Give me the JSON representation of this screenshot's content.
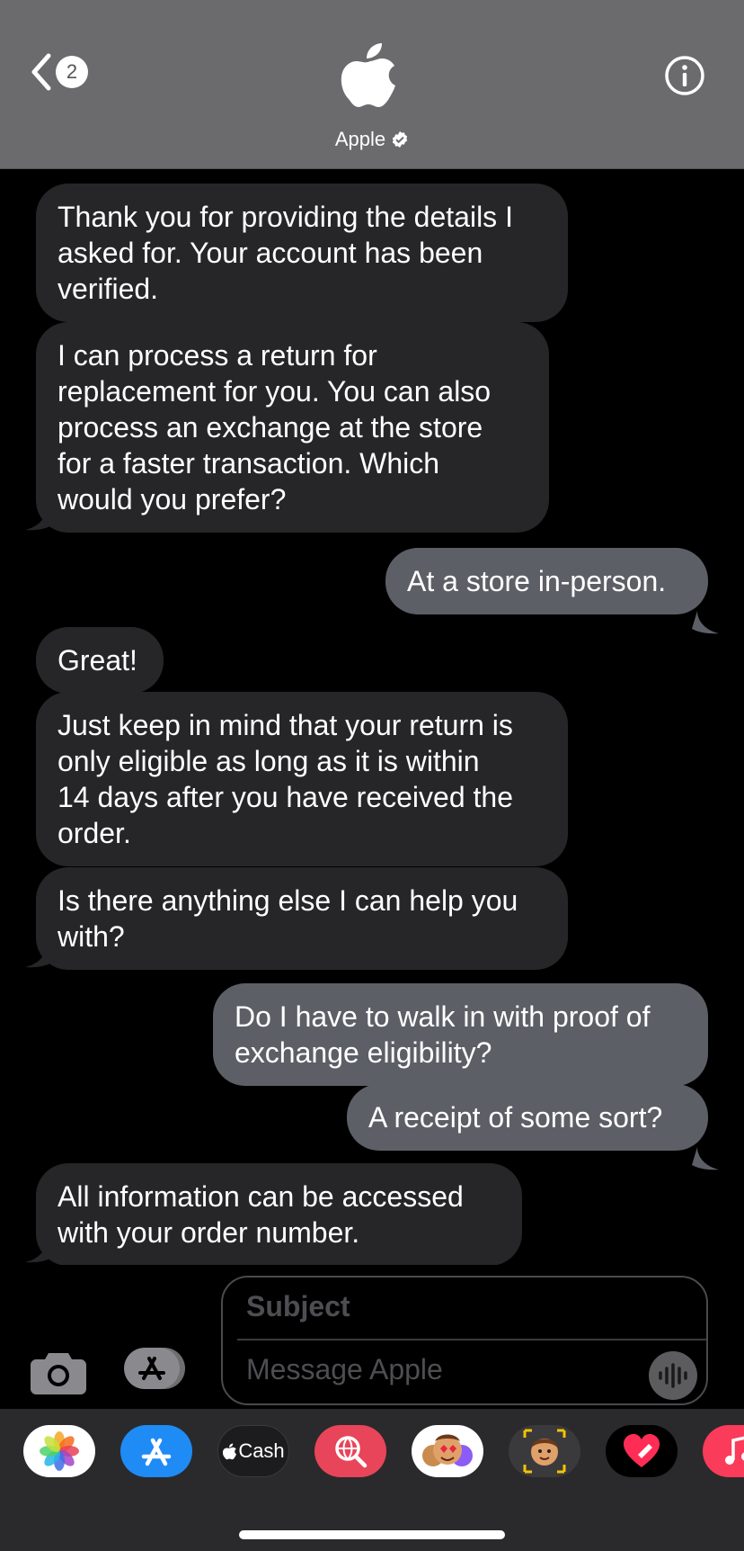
{
  "header": {
    "back_badge": "2",
    "contact_name": "Apple",
    "logo_icon": "apple-logo",
    "verified_icon": "verified-badge",
    "info_icon": "info-icon"
  },
  "messages": [
    {
      "from": "business",
      "text": "Thank you for providing the details I\nasked for. Your account has been\nverified."
    },
    {
      "from": "business",
      "text": "I can process a return for\nreplacement for you. You can also\nprocess an exchange at the store\nfor a faster transaction. Which\nwould you prefer?"
    },
    {
      "from": "me",
      "text": "At a store in-person."
    },
    {
      "from": "business",
      "text": "Great!"
    },
    {
      "from": "business",
      "text": "Just keep in mind that your return is\nonly eligible as long as it is within\n14 days after you have received the\norder."
    },
    {
      "from": "business",
      "text": "Is there anything else I can help you\nwith?"
    },
    {
      "from": "me",
      "text": "Do I have to walk in with proof of\nexchange eligibility?"
    },
    {
      "from": "me",
      "text": "A receipt of some sort?"
    },
    {
      "from": "business",
      "text": "All information can be accessed\nwith your order number."
    }
  ],
  "compose": {
    "subject_placeholder": "Subject",
    "message_placeholder": "Message Apple",
    "camera_icon": "camera-icon",
    "apps_icon": "app-store-icon",
    "mic_icon": "audio-waveform-icon"
  },
  "drawer": {
    "apps": [
      "photos",
      "app-store",
      "apple-cash",
      "search-images",
      "memoji-stickers",
      "memoji",
      "digital-touch",
      "music"
    ],
    "cash_label": "Cash"
  },
  "colors": {
    "incoming_bubble": "#262628",
    "outgoing_bubble": "#5c5f66",
    "header_bg": "#6b6b6d"
  }
}
